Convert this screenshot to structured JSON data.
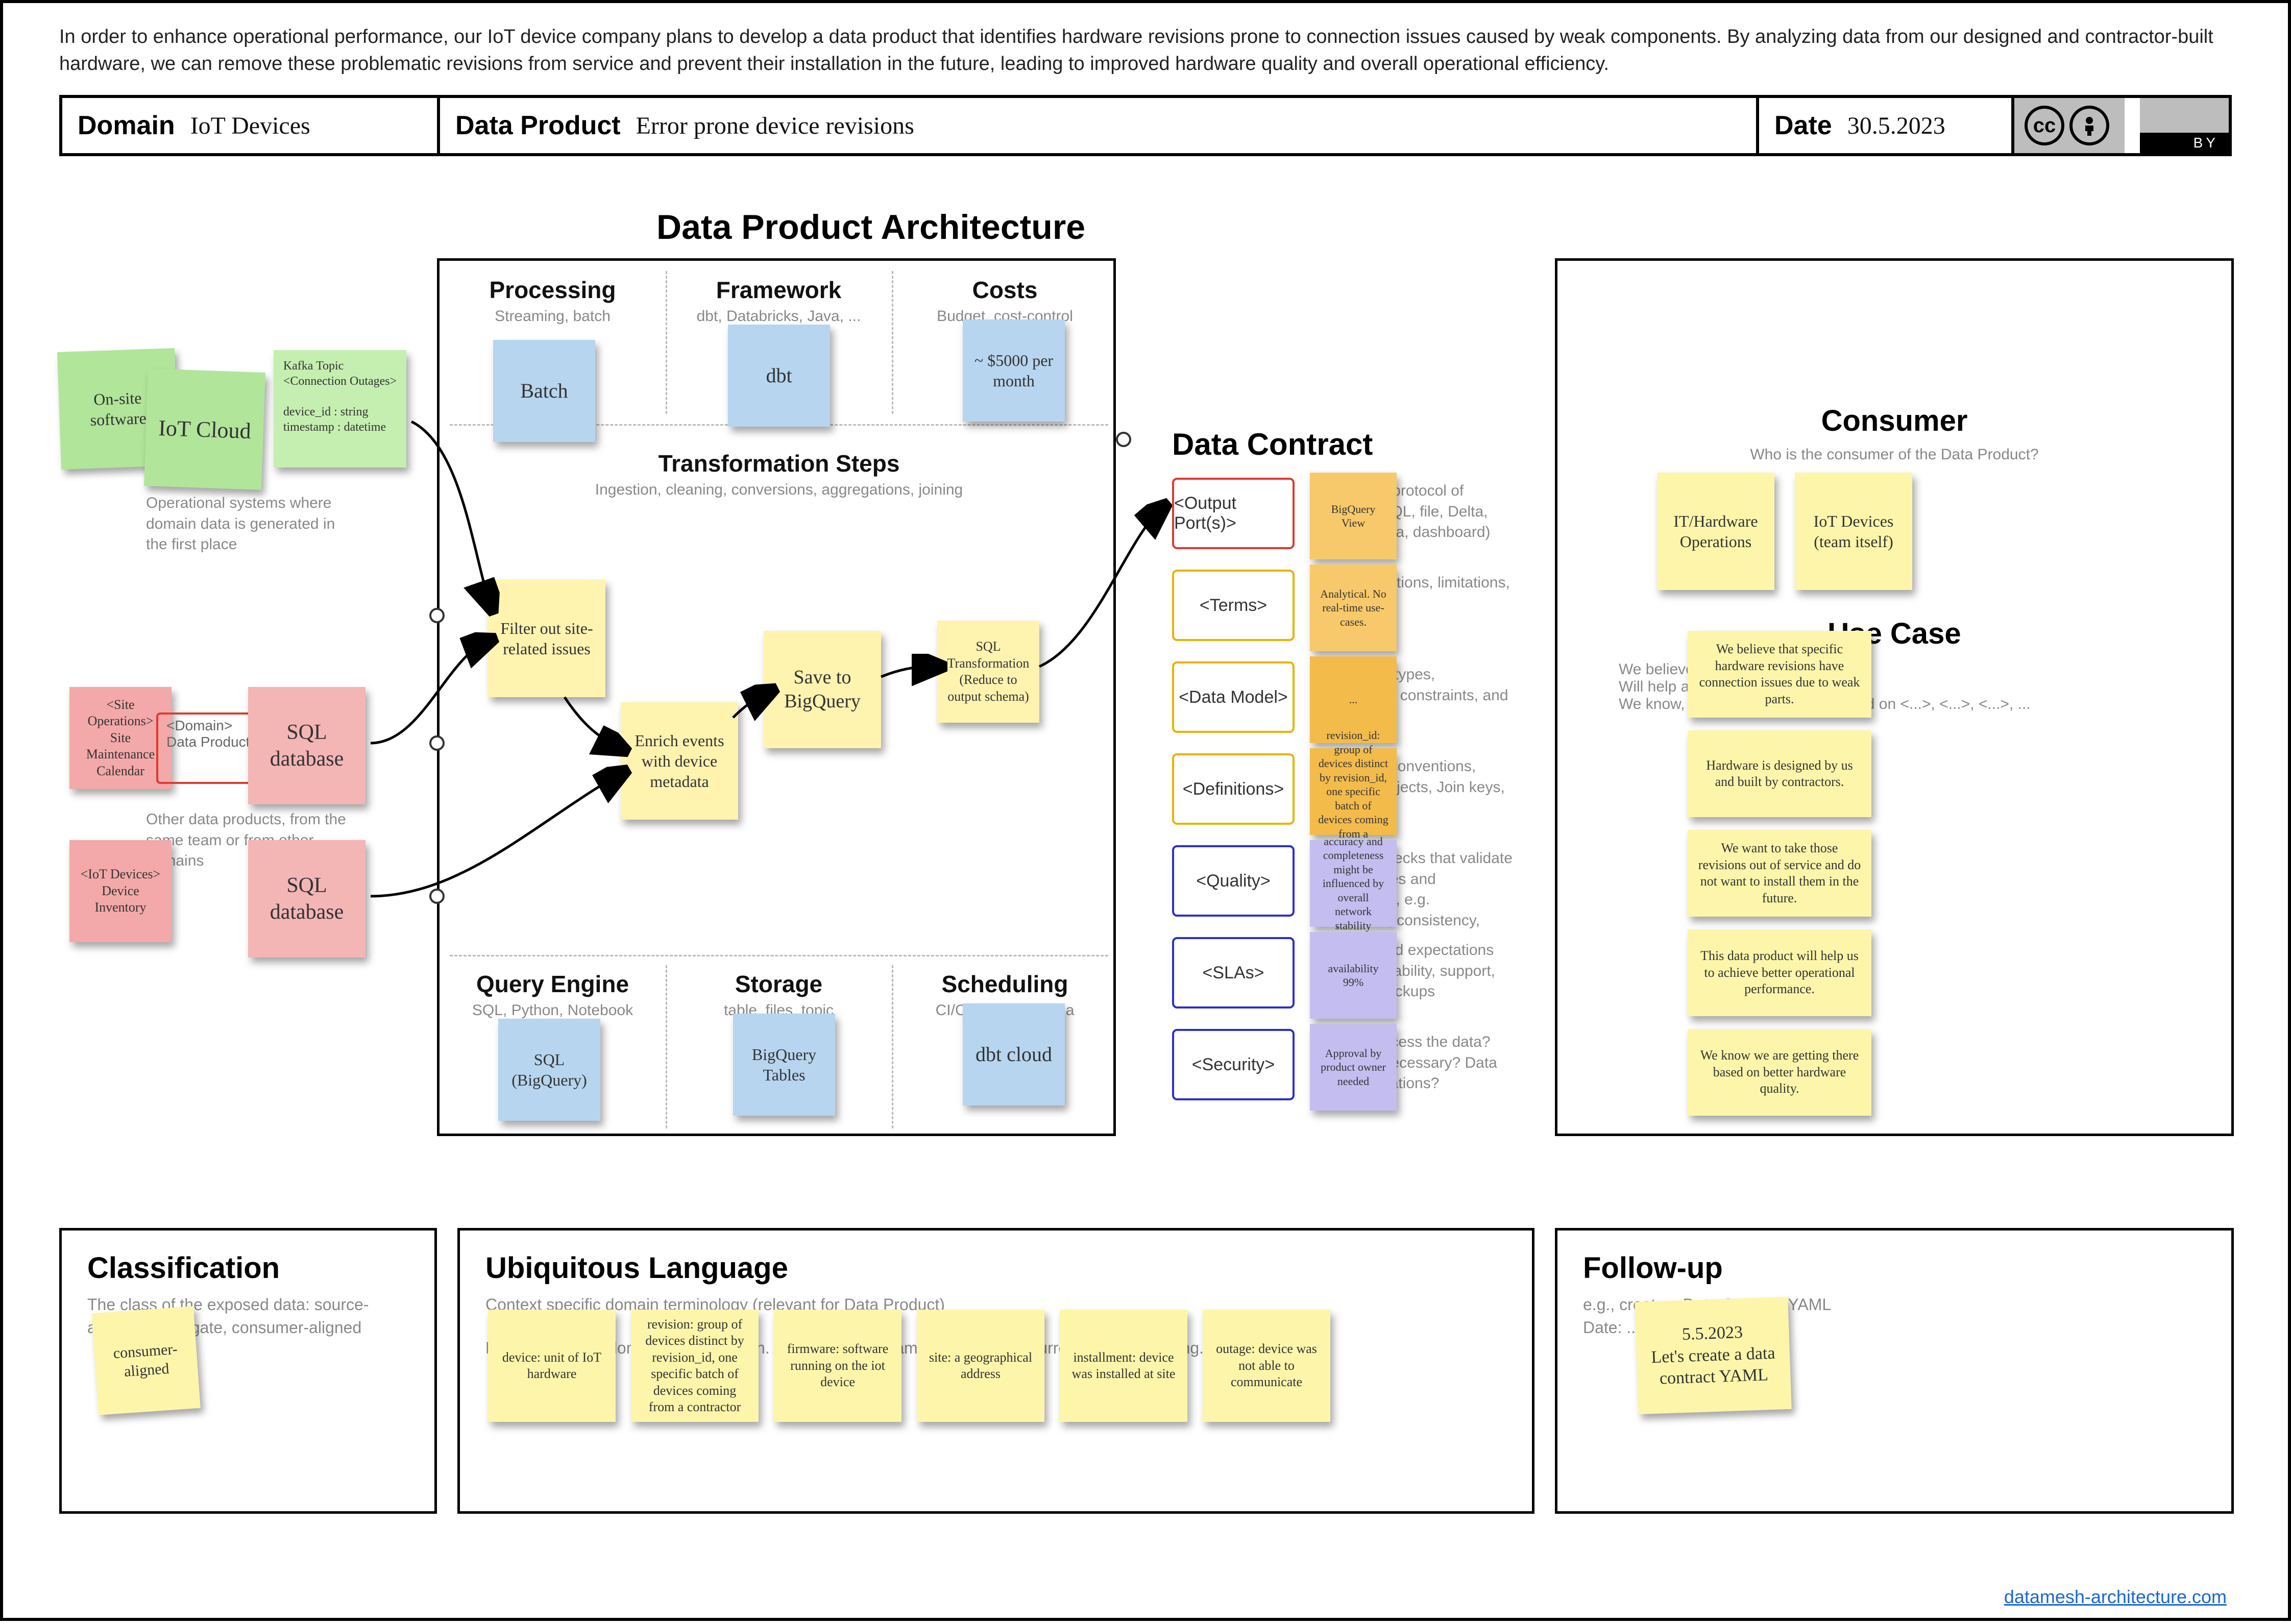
{
  "intro": "In order to enhance operational performance, our IoT device company plans to develop a data product that identifies hardware revisions prone to connection issues caused by weak components. By analyzing data from our designed and contractor-built hardware, we can remove these problematic revisions from service and prevent their installation in the future, leading to improved hardware quality and overall operational efficiency.",
  "bar": {
    "domain_label": "Domain",
    "domain_value": "IoT Devices",
    "product_label": "Data Product",
    "product_value": "Error prone device revisions",
    "date_label": "Date",
    "date_value": "30.5.2023",
    "cc_by": "BY",
    "cc_text": "cc"
  },
  "source_caption_1": "Operational systems where domain data is generated in the first place",
  "source_caption_2": "Other data products, from the same team or from other domains",
  "source": {
    "onsite": "On-site software",
    "iot_cloud": "IoT Cloud",
    "kafka": "Kafka Topic\n<Connection Outages>\n\ndevice_id : string\ntimestamp : datetime",
    "site_ops": "<Site Operations>\nSite Maintenance Calendar",
    "domain_dp": "<Domain>\nData Product",
    "sql1": "SQL database",
    "iot_dev": "<IoT Devices>\nDevice Inventory",
    "sql2": "SQL database"
  },
  "arch": {
    "title": "Data Product Architecture",
    "processing_h": "Processing",
    "processing_s": "Streaming, batch",
    "framework_h": "Framework",
    "framework_s": "dbt, Databricks, Java, ...",
    "costs_h": "Costs",
    "costs_s": "Budget, cost-control",
    "transform_h": "Transformation Steps",
    "transform_s": "Ingestion, cleaning, conversions, aggregations, joining",
    "query_h": "Query Engine",
    "query_s": "SQL, Python, Notebook",
    "storage_h": "Storage",
    "storage_s": "table, files, topic",
    "sched_h": "Scheduling",
    "sched_s": "CI/CD, Airflow, Soda",
    "notes": {
      "batch": "Batch",
      "dbt": "dbt",
      "cost": "~ $5000 per month",
      "filter": "Filter out site-related issues",
      "enrich": "Enrich events with device metadata",
      "save": "Save to BigQuery",
      "sqltrans": "SQL Transformation (Reduce to output schema)",
      "qe": "SQL (BigQuery)",
      "storage": "BigQuery Tables",
      "sched": "dbt cloud"
    }
  },
  "dc": {
    "title": "Data Contract",
    "rows": [
      {
        "label": "<Output Port(s)>",
        "text": "The offered protocol of provision (SQL, file, Delta, topic, schema, dashboard)",
        "border": "#e03a2f",
        "note": "BigQuery View",
        "note_color": "amber"
      },
      {
        "label": "<Terms>",
        "text": "Terms, conditions, limitations, pricing",
        "border": "#e7b400",
        "note": "Analytical. No real-time use-cases.",
        "note_color": "amber"
      },
      {
        "label": "<Data Model>",
        "text": "Model, data types, descriptions, constraints, and relations",
        "border": "#e7b400",
        "note": "...",
        "note_color": "amber2"
      },
      {
        "label": "<Definitions>",
        "text": "Semantics, conventions, Business Objects, Join keys, PII, ...",
        "border": "#e7b400",
        "note": "revision_id: group of devices distinct by revision_id, one specific batch of devices coming from a contractor",
        "note_color": "amber2"
      },
      {
        "label": "<Quality>",
        "text": "Technical checks that validate data promises and expectations, e.g. uniqueness, consistency, freshness, ...",
        "border": "#2b2fd0",
        "note": "accuracy and completeness might be influenced by overall network stability",
        "note_color": "violet"
      },
      {
        "label": "<SLAs>",
        "text": "Promises and expectations around availability, support, retention, backups",
        "border": "#2b2fd0",
        "note": "availability 99%",
        "note_color": "violet"
      },
      {
        "label": "<Security>",
        "text": "Who can access the data? Approvals necessary? Data privacy limitations?",
        "border": "#2b2fd0",
        "note": "Approval by product owner needed",
        "note_color": "violet"
      }
    ]
  },
  "consumer": {
    "title": "Consumer",
    "subtitle": "Who is the consumer of the Data Product?",
    "note1": "IT/Hardware Operations",
    "note2": "IoT Devices (team itself)",
    "usecase_title": "Use Case",
    "usecase_sub": "We believe that ...\nWill help achieve ...\nWe know, we have succeeded, based on <...>, <...>, <...>, ...",
    "uc_notes": [
      "We believe that specific hardware revisions have connection issues due to weak parts.",
      "Hardware is designed by us and built by contractors.",
      "We want to take those revisions out of service and do not want to install them in the future.",
      "This data product will help us to achieve better operational performance.",
      "We know we are getting there based on better hardware quality."
    ]
  },
  "classification": {
    "title": "Classification",
    "sub": "The class of the exposed data: source-aligned, aggregate, consumer-aligned",
    "note": "consumer-aligned"
  },
  "ulang": {
    "title": "Ubiquitous Language",
    "sub1": "Context specific domain terminology (relevant for Data Product)",
    "sub2": "Data Mesh uses domain-driven-design. Please use the same language the current domain is using.",
    "notes": [
      "device: unit of IoT hardware",
      "revision: group of devices distinct by revision_id, one specific batch of devices coming from a contractor",
      "firmware: software running on the iot device",
      "site: a geographical address",
      "installment: device was installed at site",
      "outage: device was not able to communicate"
    ]
  },
  "followup": {
    "title": "Follow-up",
    "sub": "e.g., create a Data Contract YAML\nDate: ...",
    "note": "5.5.2023\nLet's create a data contract YAML"
  },
  "footer": "datamesh-architecture.com"
}
